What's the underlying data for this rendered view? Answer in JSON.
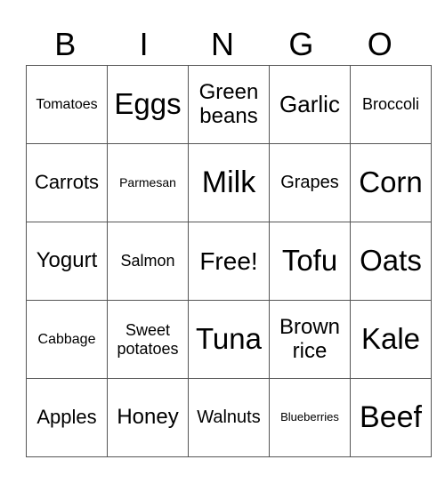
{
  "header": {
    "letters": [
      "B",
      "I",
      "N",
      "G",
      "O"
    ]
  },
  "grid": {
    "rows": [
      [
        "Tomatoes",
        "Eggs",
        "Green beans",
        "Garlic",
        "Broccoli"
      ],
      [
        "Carrots",
        "Parmesan",
        "Milk",
        "Grapes",
        "Corn"
      ],
      [
        "Yogurt",
        "Salmon",
        "Free!",
        "Tofu",
        "Oats"
      ],
      [
        "Cabbage",
        "Sweet potatoes",
        "Tuna",
        "Brown rice",
        "Kale"
      ],
      [
        "Apples",
        "Honey",
        "Walnuts",
        "Blueberries",
        "Beef"
      ]
    ]
  },
  "colors": {
    "grid_line": "#555555",
    "text": "#000000",
    "background": "#ffffff"
  }
}
